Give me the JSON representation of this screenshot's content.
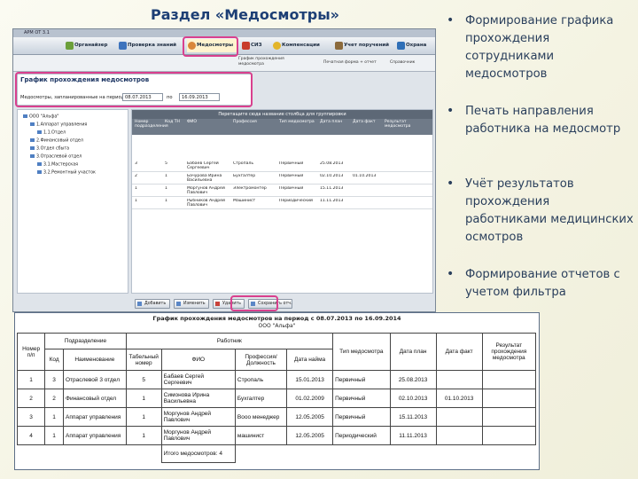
{
  "heading": "Раздел «Медосмотры»",
  "bullets": [
    "Формирование графика прохождения сотрудниками медосмотров",
    "Печать направления работника на медосмотр",
    "Учёт результатов прохождения работниками медицинских осмотров",
    "Формирование отчетов с учетом фильтра"
  ],
  "app": {
    "title": "АРМ ОТ 3.1",
    "toolbar": [
      "Органайзер",
      "Проверка знаний",
      "Медосмотры",
      "СИЗ",
      "Компенсации",
      "Учет поручений",
      "Охрана"
    ],
    "ribbon": {
      "left_item": "График прохождения медосмотра",
      "right_items": [
        "Печатная форма + отчет",
        "Справочник"
      ]
    },
    "filter": {
      "title": "График прохождения медосмотров",
      "label": "Медосмотры, запланированные на период с",
      "date_from": "08.07.2013",
      "to_label": "по",
      "date_to": "16.09.2013"
    },
    "tree": [
      "ООО \"Альфа\"",
      "1.Аппарат управления",
      "1.1.Отдел",
      "2.Финансовый отдел",
      "3.Отдел сбыта",
      "3.Отраслевой отдел",
      "3.1.Мастерская",
      "3.2.Ремонтный участок"
    ],
    "grid": {
      "group_bar": "Перетащите сюда название столбца для группировки",
      "headers": [
        "Номер подразделения",
        "Код ТН",
        "ФИО",
        "Профессия",
        "Тип медосмотра",
        "Дата план",
        "Дата факт",
        "Результат медосмотра"
      ],
      "rows": [
        [
          "3",
          "5",
          "Бабаев Сергей Сергеевич",
          "Стропаль",
          "Первичный",
          "25.08.2013",
          "",
          ""
        ],
        [
          "2",
          "1",
          "Бачурова Ирина Васильевна",
          "Бухгалтер",
          "Первичный",
          "02.10.2013",
          "01.10.2013",
          ""
        ],
        [
          "1",
          "1",
          "Моргунов Андрей Павлович",
          "Электромонтер",
          "Первичный",
          "15.11.2013",
          "",
          ""
        ],
        [
          "1",
          "1",
          "Рыбников Андрей Павлович",
          "Машинист",
          "Периодический",
          "11.11.2013",
          "",
          ""
        ]
      ]
    },
    "buttons": [
      "Добавить",
      "Изменить",
      "Удалить",
      "Сохранить отч."
    ]
  },
  "report": {
    "title": "График прохождения медосмотров на период с 08.07.2013 по 16.09.2014",
    "org": "ООО \"Альфа\"",
    "headers": {
      "num": "Номер п/п",
      "division": "Подразделение",
      "code": "Код",
      "name": "Наименование",
      "worker": "Работник",
      "tabnum": "Табельный номер",
      "fio": "ФИО",
      "profession": "Профессия/ Должность",
      "hire": "Дата найма",
      "type": "Тип медосмотра",
      "plan": "Дата план",
      "fact": "Дата факт",
      "result": "Результат прохождения медосмотра"
    },
    "rows": [
      {
        "num": "1",
        "code": "3",
        "name": "Отраслевой 3 отдел",
        "tab": "5",
        "fio": "Бабаев Сергей Сергеевич",
        "prof": "Стропаль",
        "hire": "15.01.2013",
        "type": "Первичный",
        "plan": "25.08.2013",
        "fact": "",
        "result": ""
      },
      {
        "num": "2",
        "code": "2",
        "name": "Финансовый отдел",
        "tab": "1",
        "fio": "Симонова Ирина Васильевна",
        "prof": "Бухгалтер",
        "hire": "01.02.2009",
        "type": "Первичный",
        "plan": "02.10.2013",
        "fact": "01.10.2013",
        "result": ""
      },
      {
        "num": "3",
        "code": "1",
        "name": "Аппарат управления",
        "tab": "1",
        "fio": "Моргунов Андрей Павлович",
        "prof": "Вооо менеджер",
        "hire": "12.05.2005",
        "type": "Первичный",
        "plan": "15.11.2013",
        "fact": "",
        "result": ""
      },
      {
        "num": "4",
        "code": "1",
        "name": "Аппарат управления",
        "tab": "1",
        "fio": "Моргунов Андрей Павлович",
        "prof": "машинист",
        "hire": "12.05.2005",
        "type": "Периодический",
        "plan": "11.11.2013",
        "fact": "",
        "result": ""
      }
    ],
    "total_label": "Итого медосмотров:",
    "total_value": "4"
  },
  "colors": {
    "heading": "#1d3f75",
    "highlight": "#d9408e",
    "grid_header": "#6f7a88"
  }
}
